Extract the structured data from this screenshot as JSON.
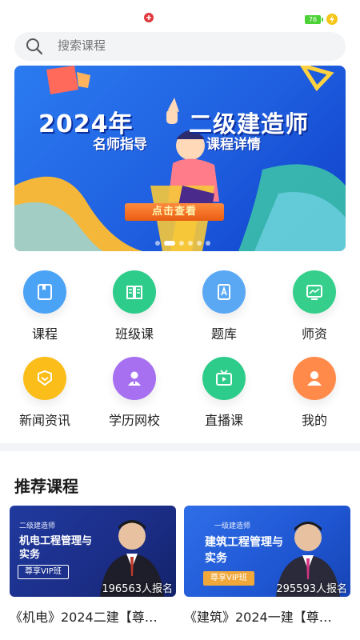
{
  "status_bar": {
    "battery": "76"
  },
  "search": {
    "placeholder": "搜索课程"
  },
  "banner": {
    "year": "2024年",
    "sub_left": "名师指导",
    "job": "二级建造师",
    "sub_right": "课程详情",
    "button": "点击查看",
    "slide_count": 6,
    "active_slide": 1
  },
  "menu": [
    {
      "label": "课程",
      "icon": "book-icon",
      "color": "#4aa3f5"
    },
    {
      "label": "班级课",
      "icon": "open-book-icon",
      "color": "#2ecc8a"
    },
    {
      "label": "题库",
      "icon": "question-bank-icon",
      "color": "#5aa8f3"
    },
    {
      "label": "师资",
      "icon": "teacher-board-icon",
      "color": "#35cf8b"
    },
    {
      "label": "新闻资讯",
      "icon": "news-icon",
      "color": "#fbbd1a"
    },
    {
      "label": "学历网校",
      "icon": "student-icon",
      "color": "#a670f0"
    },
    {
      "label": "直播课",
      "icon": "live-video-icon",
      "color": "#2ecc8a"
    },
    {
      "label": "我的",
      "icon": "profile-icon",
      "color": "#ff8a4a"
    }
  ],
  "recommend": {
    "title": "推荐课程",
    "cards": [
      {
        "tag": "二级建造师",
        "thumb_title": "机电工程管理与实务",
        "vip": "尊享VIP班",
        "enroll": "196563人报名",
        "title": "《机电》2024二建【尊…",
        "sub": "  "
      },
      {
        "tag": "一级建造师",
        "thumb_title": "建筑工程管理与实务",
        "vip": "尊享VIP班",
        "enroll": "295593人报名",
        "title": "《建筑》2024一建【尊…",
        "sub": "  "
      }
    ]
  }
}
